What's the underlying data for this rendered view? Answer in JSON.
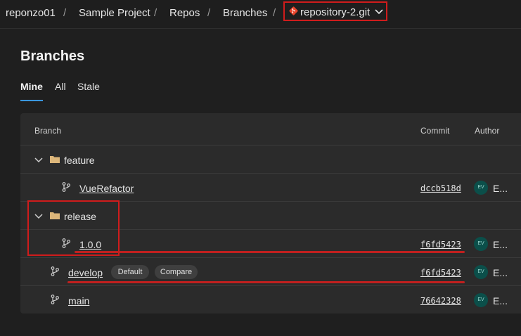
{
  "breadcrumb": {
    "org": "reponzo01",
    "project": "Sample Project",
    "repos": "Repos",
    "branches": "Branches",
    "repo": "repository-2.git",
    "separator": "/"
  },
  "page": {
    "title": "Branches"
  },
  "tabs": [
    {
      "label": "Mine",
      "active": true
    },
    {
      "label": "All",
      "active": false
    },
    {
      "label": "Stale",
      "active": false
    }
  ],
  "table": {
    "columns": {
      "branch": "Branch",
      "commit": "Commit",
      "author": "Author"
    },
    "rows": [
      {
        "type": "folder",
        "name": "feature",
        "expanded": true
      },
      {
        "type": "branch",
        "name": "VueRefactor",
        "commit": "dccb518d",
        "avatar": "EV",
        "author": "E..."
      },
      {
        "type": "folder",
        "name": "release",
        "expanded": true
      },
      {
        "type": "branch",
        "name": "1.0.0",
        "commit": "f6fd5423",
        "avatar": "EV",
        "author": "E..."
      },
      {
        "type": "branch",
        "name": "develop",
        "commit": "f6fd5423",
        "avatar": "EV",
        "author": "E...",
        "badges": [
          "Default",
          "Compare"
        ]
      },
      {
        "type": "branch",
        "name": "main",
        "commit": "76642328",
        "avatar": "EV",
        "author": "E..."
      }
    ]
  },
  "colors": {
    "accent": "#3a96dd",
    "highlight": "#d01c1c",
    "git": "#e8442b"
  }
}
